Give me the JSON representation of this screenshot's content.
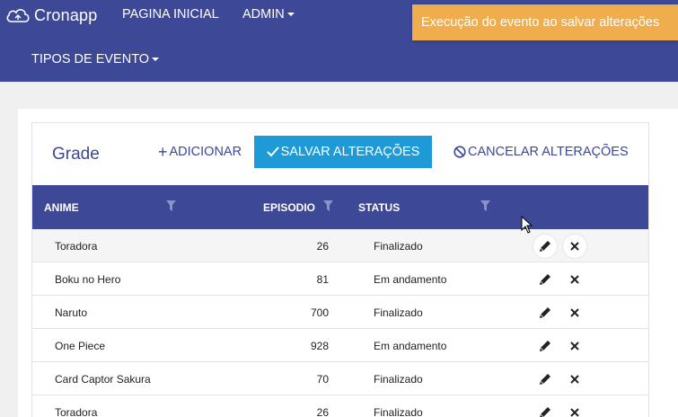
{
  "navbar": {
    "brand": "Cronapp",
    "items": [
      {
        "label": "PAGINA INICIAL"
      },
      {
        "label": "ADMIN"
      },
      {
        "label": "TIPOS DE EVENTO"
      }
    ]
  },
  "toast": {
    "message": "Execução do evento ao salvar alterações"
  },
  "grid": {
    "title": "Grade",
    "add_label": "ADICIONAR",
    "save_label": "SALVAR ALTERAÇÕES",
    "cancel_label": "CANCELAR ALTERAÇÕES",
    "columns": {
      "anime": "ANIME",
      "episodio": "EPISODIO",
      "status": "STATUS"
    },
    "rows": [
      {
        "anime": "Toradora",
        "episodio": "26",
        "status": "Finalizado"
      },
      {
        "anime": "Boku no Hero",
        "episodio": "81",
        "status": "Em andamento"
      },
      {
        "anime": "Naruto",
        "episodio": "700",
        "status": "Finalizado"
      },
      {
        "anime": "One Piece",
        "episodio": "928",
        "status": "Em andamento"
      },
      {
        "anime": "Card Captor Sakura",
        "episodio": "70",
        "status": "Finalizado"
      },
      {
        "anime": "Toradora",
        "episodio": "26",
        "status": "Finalizado"
      }
    ]
  },
  "colors": {
    "primary": "#3d4896",
    "accent": "#1e9bd6",
    "warning": "#f0ad4e"
  },
  "icons": [
    "cloud-icon",
    "caret-down-icon",
    "plus-icon",
    "check-icon",
    "cancel-icon",
    "filter-icon",
    "pencil-icon",
    "close-icon"
  ]
}
